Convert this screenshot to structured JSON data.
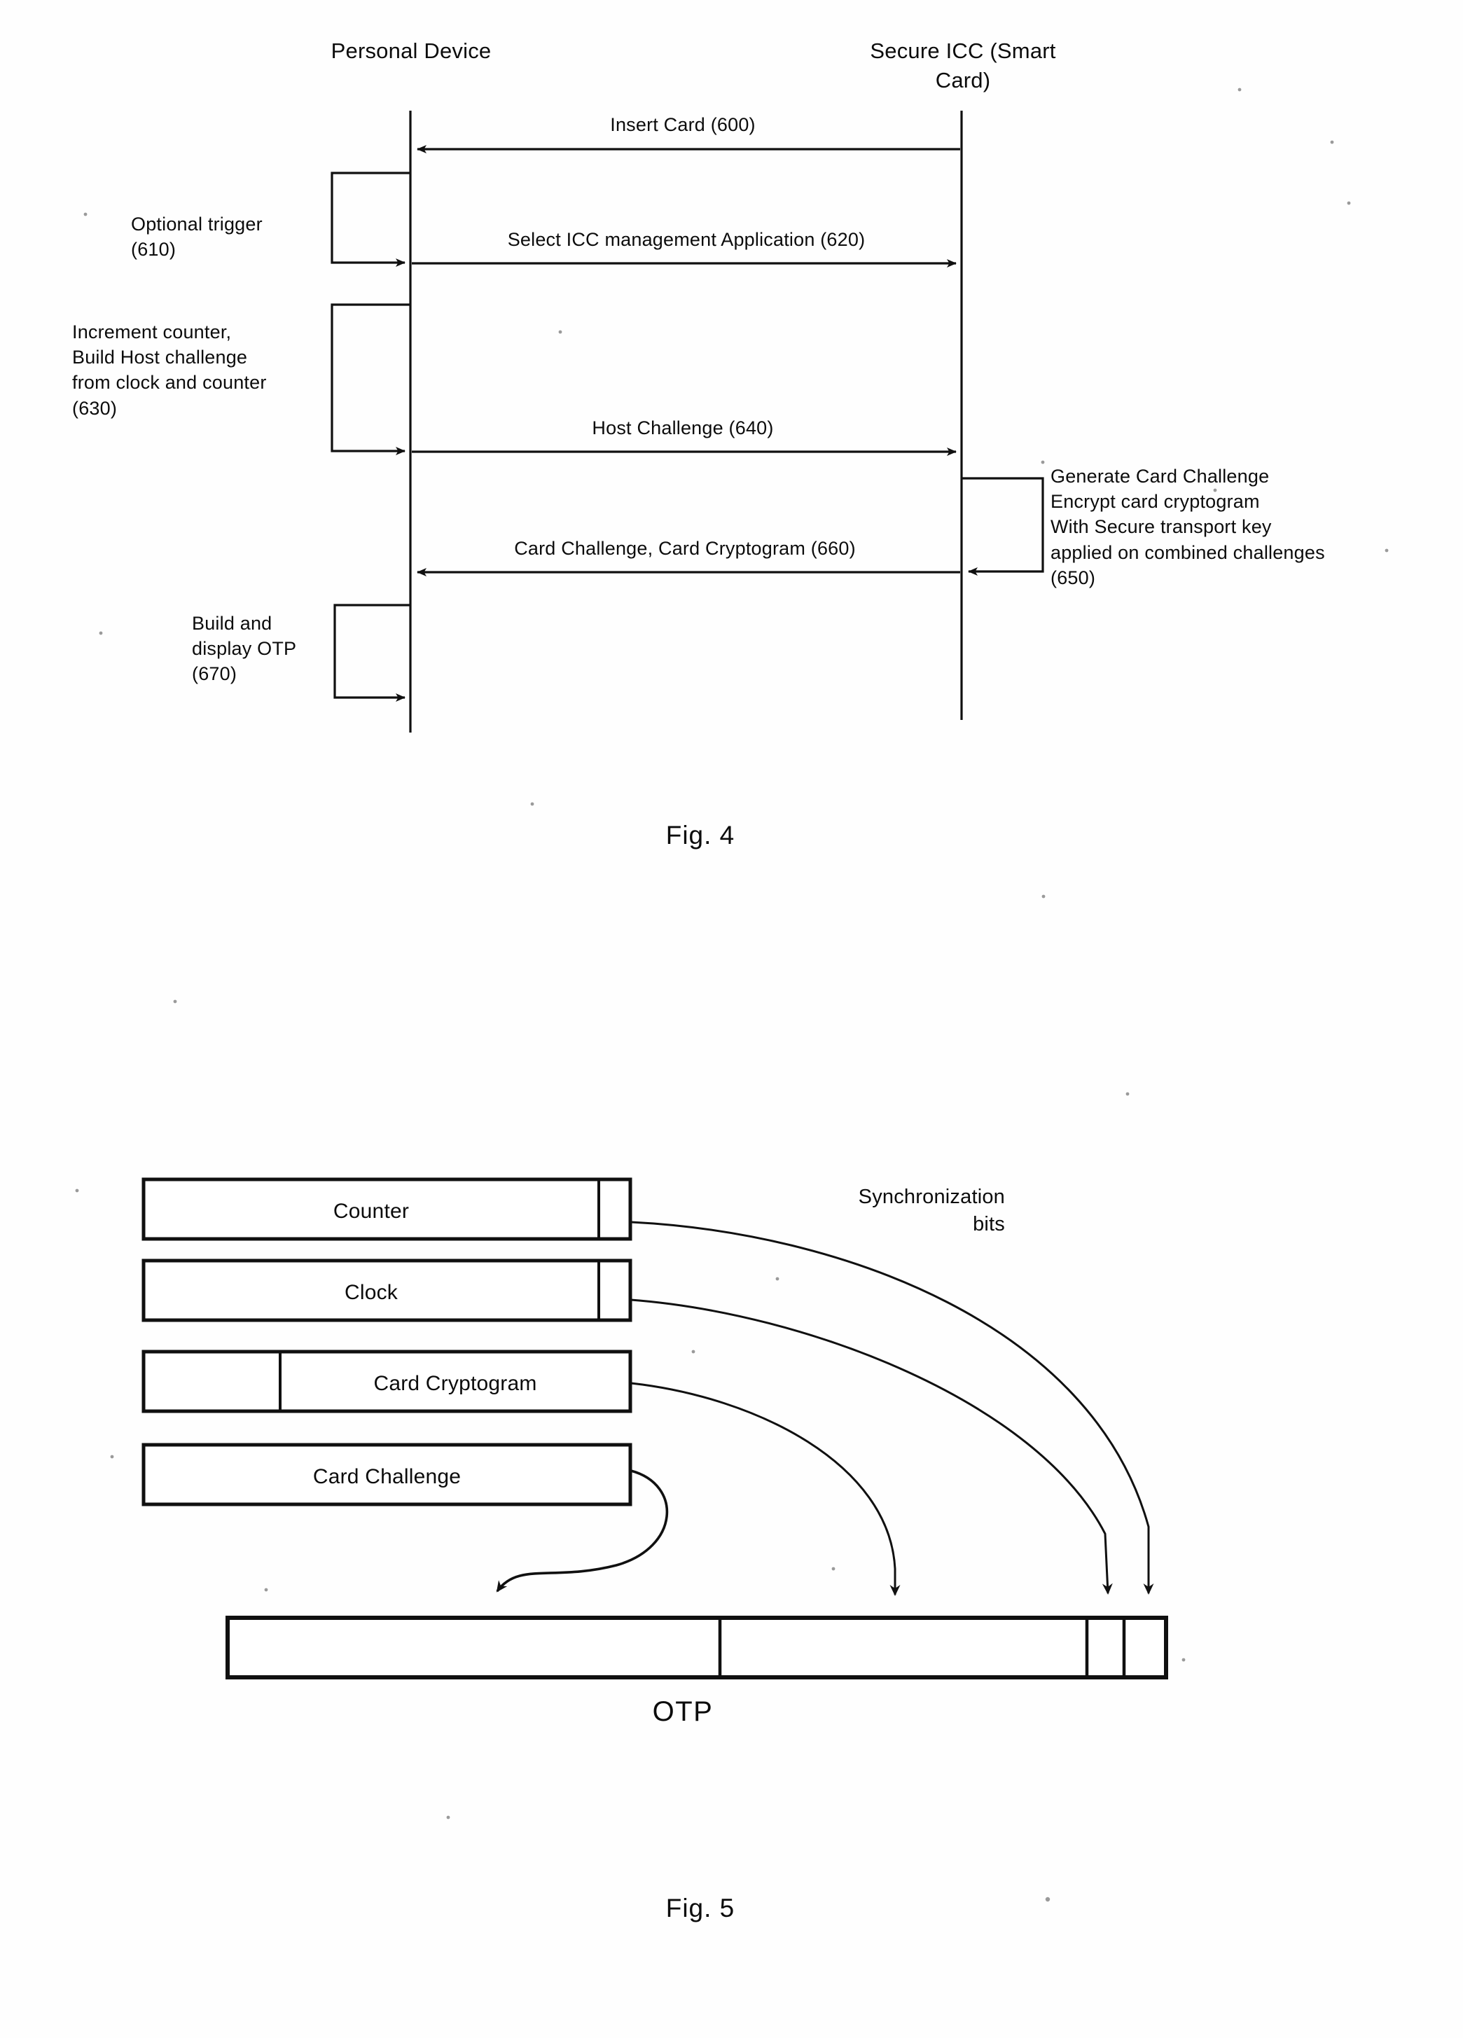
{
  "figures": [
    {
      "id": "fig4",
      "caption": "Fig. 4",
      "type": "sequence-diagram",
      "lifelines": [
        {
          "name": "personal-device",
          "label": "Personal Device"
        },
        {
          "name": "secure-icc",
          "label": "Secure ICC (Smart\nCard)"
        }
      ],
      "messages": [
        {
          "ref": "600",
          "label": "Insert Card (600)",
          "direction": "right-to-left"
        },
        {
          "ref": "620",
          "label": "Select ICC management Application (620)",
          "direction": "left-to-right"
        },
        {
          "ref": "640",
          "label": "Host Challenge (640)",
          "direction": "left-to-right"
        },
        {
          "ref": "660",
          "label": "Card Challenge, Card Cryptogram (660)",
          "direction": "right-to-left"
        }
      ],
      "activities": [
        {
          "ref": "610",
          "side": "left",
          "label": "Optional trigger\n(610)"
        },
        {
          "ref": "630",
          "side": "left",
          "label": "Increment counter,\nBuild Host challenge\nfrom clock and counter\n(630)"
        },
        {
          "ref": "650",
          "side": "right",
          "label": "Generate Card Challenge\nEncrypt card cryptogram\nWith Secure transport key\napplied on combined challenges\n(650)"
        },
        {
          "ref": "670",
          "side": "left",
          "label": "Build and\ndisplay OTP\n(670)"
        }
      ]
    },
    {
      "id": "fig5",
      "caption": "Fig. 5",
      "type": "composition-diagram",
      "sources": [
        {
          "name": "counter",
          "label": "Counter",
          "has_tail_segment": true
        },
        {
          "name": "clock",
          "label": "Clock",
          "has_tail_segment": true
        },
        {
          "name": "card-cryptogram",
          "label": "Card Cryptogram",
          "has_head_segment": true
        },
        {
          "name": "card-challenge",
          "label": "Card Challenge",
          "has_head_segment": false
        }
      ],
      "annotation": "Synchronization\nbits",
      "target": {
        "name": "otp-bar",
        "label": "OTP",
        "segments": [
          "card-challenge",
          "card-cryptogram",
          "clock",
          "counter"
        ]
      }
    }
  ]
}
